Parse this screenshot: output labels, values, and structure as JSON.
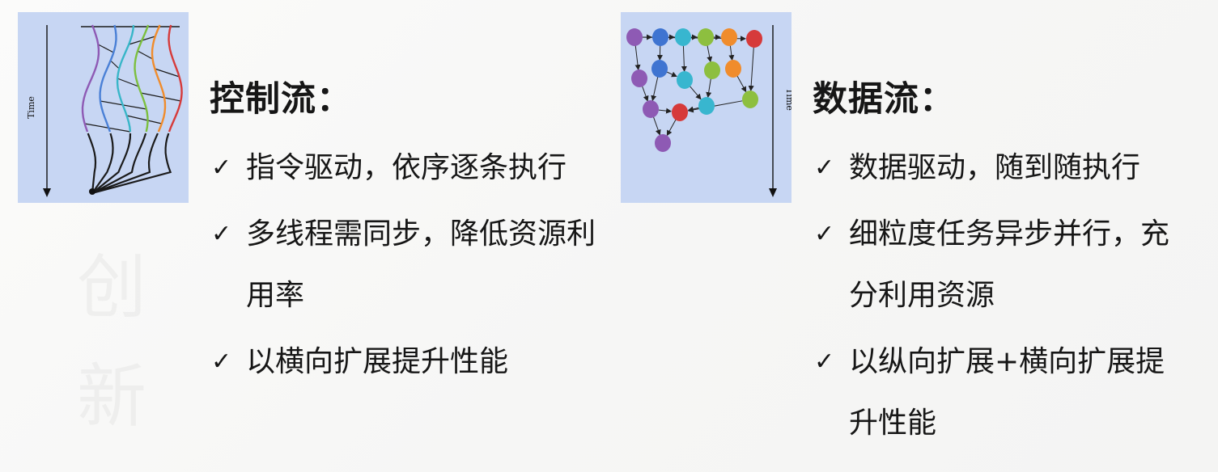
{
  "control_flow": {
    "title": "控制流：",
    "figure_axis_label": "Time",
    "items": [
      {
        "text": "指令驱动，依序逐条执行"
      },
      {
        "text": "多线程需同步，降低资源利用率"
      },
      {
        "text": "以横向扩展提升性能"
      }
    ],
    "figure_colors": [
      "#8e5ab4",
      "#4a80d6",
      "#38b6c8",
      "#7cbf3f",
      "#f08c2c",
      "#d63a3a"
    ]
  },
  "data_flow": {
    "title": "数据流：",
    "figure_axis_label": "Time",
    "items": [
      {
        "text": "数据驱动，随到随执行"
      },
      {
        "text": "细粒度任务异步并行，充分利用资源"
      },
      {
        "text": "以纵向扩展+横向扩展提升性能"
      }
    ],
    "node_colors": {
      "purple": "#8e5ab4",
      "blue": "#3f74d1",
      "cyan": "#38b6cf",
      "green": "#8dbf3f",
      "orange": "#f08c2c",
      "red": "#d63a3a"
    }
  },
  "check_icon": "✓"
}
